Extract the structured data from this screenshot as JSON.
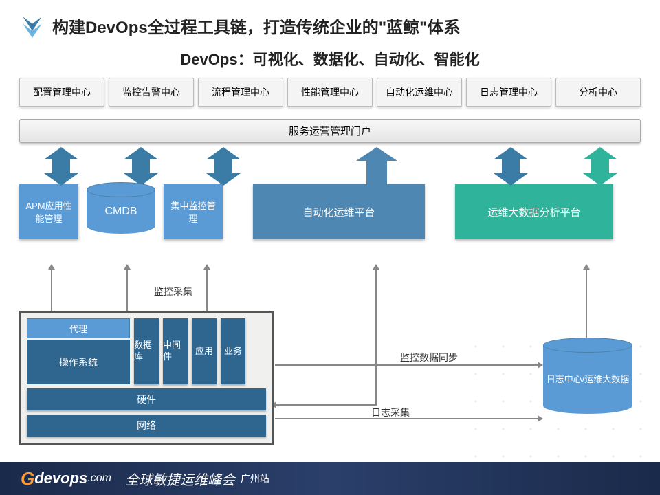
{
  "title": "构建DevOps全过程工具链，打造传统企业的\"蓝鲸\"体系",
  "subtitle": "DevOps：可视化、数据化、自动化、智能化",
  "centers": [
    "配置管理中心",
    "监控告警中心",
    "流程管理中心",
    "性能管理中心",
    "自动化运维中心",
    "日志管理中心",
    "分析中心"
  ],
  "portal": "服务运营管理门户",
  "platforms": {
    "apm": "APM应用性能管理",
    "cmdb": "CMDB",
    "monitor": "集中监控管理",
    "automation": "自动化运维平台",
    "bigdata": "运维大数据分析平台"
  },
  "labels": {
    "monitor_collect": "监控采集",
    "monitor_sync": "监控数据同步",
    "log_collect": "日志采集"
  },
  "infra": {
    "agent": "代理",
    "os": "操作系统",
    "stacks": [
      "数据库",
      "中间件",
      "应用",
      "业务"
    ],
    "hardware": "硬件",
    "network": "网络"
  },
  "log_db": "日志中心/运维大数据",
  "footer": {
    "brand_g": "G",
    "brand_rest": "devops",
    "brand_com": ".com",
    "tagline": "全球敏捷运维峰会",
    "city": "广州站"
  }
}
